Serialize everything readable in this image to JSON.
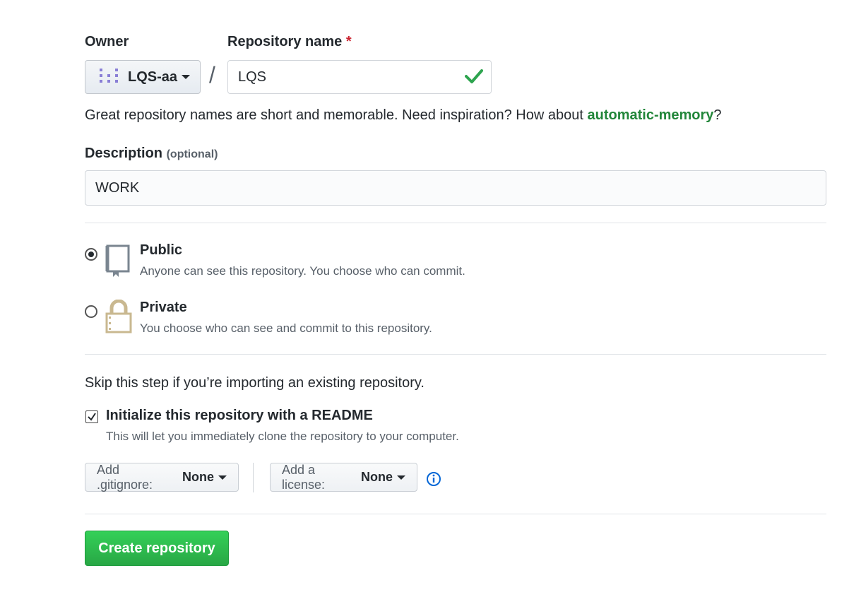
{
  "owner": {
    "label": "Owner",
    "name": "LQS-aa"
  },
  "repo": {
    "label": "Repository name",
    "required_mark": "*",
    "value": "LQS"
  },
  "hint": {
    "prefix": "Great repository names are short and memorable. Need inspiration? How about ",
    "suggestion": "automatic-memory",
    "suffix": "?"
  },
  "description": {
    "label": "Description",
    "optional": "(optional)",
    "value": "WORK"
  },
  "visibility": {
    "public": {
      "title": "Public",
      "desc": "Anyone can see this repository. You choose who can commit.",
      "selected": true
    },
    "private": {
      "title": "Private",
      "desc": "You choose who can see and commit to this repository.",
      "selected": false
    }
  },
  "init": {
    "skip_note": "Skip this step if you’re importing an existing repository.",
    "readme_label": "Initialize this repository with a README",
    "readme_desc": "This will let you immediately clone the repository to your computer.",
    "readme_checked": true
  },
  "gitignore": {
    "label": "Add .gitignore:",
    "value": "None"
  },
  "license": {
    "label": "Add a license:",
    "value": "None"
  },
  "create_button": "Create repository",
  "colors": {
    "accent_green": "#28a745",
    "suggestion_green": "#22863a",
    "required_red": "#cb2431",
    "info_blue": "#0366d6"
  }
}
